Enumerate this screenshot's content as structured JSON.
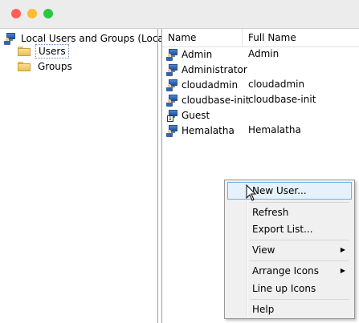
{
  "window": {
    "controls": [
      "close",
      "minimize",
      "zoom"
    ]
  },
  "tree": {
    "root": {
      "label": "Local Users and Groups (Local)",
      "icon": "computer-users-icon"
    },
    "children": [
      {
        "label": "Users",
        "icon": "folder-icon",
        "selected": true
      },
      {
        "label": "Groups",
        "icon": "folder-icon",
        "selected": false
      }
    ]
  },
  "list": {
    "columns": [
      "Name",
      "Full Name"
    ],
    "rows": [
      {
        "name": "Admin",
        "full_name": "Admin",
        "icon": "user-icon"
      },
      {
        "name": "Administrator",
        "full_name": "",
        "icon": "user-icon"
      },
      {
        "name": "cloudadmin",
        "full_name": "cloudadmin",
        "icon": "user-icon"
      },
      {
        "name": "cloudbase-init",
        "full_name": "cloudbase-init",
        "icon": "user-icon"
      },
      {
        "name": "Guest",
        "full_name": "",
        "icon": "disabled-user-icon"
      },
      {
        "name": "Hemalatha",
        "full_name": "Hemalatha",
        "icon": "user-icon"
      }
    ]
  },
  "context_menu": {
    "items": [
      {
        "label": "New User...",
        "highlighted": true
      },
      {
        "label": "Refresh"
      },
      {
        "label": "Export List..."
      },
      {
        "label": "View",
        "submenu": true
      },
      {
        "label": "Arrange Icons",
        "submenu": true
      },
      {
        "label": "Line up Icons"
      },
      {
        "label": "Help"
      }
    ],
    "submenu_arrow": "▶"
  },
  "colors": {
    "highlight_bg": "#e5f1fb",
    "highlight_border": "#76aee3",
    "close": "#fe5f57",
    "minimize": "#febc2e",
    "zoom": "#28c840"
  }
}
